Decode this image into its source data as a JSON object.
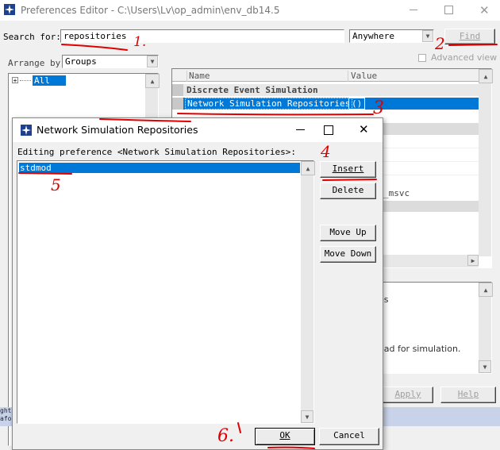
{
  "window": {
    "title": "Preferences Editor - C:\\Users\\Lv\\op_admin\\env_db14.5"
  },
  "search": {
    "label": "Search for:",
    "value": "repositories",
    "scope": "Anywhere",
    "find_label": "Find"
  },
  "arrange": {
    "label": "Arrange by",
    "value": "Groups"
  },
  "tree": {
    "items": [
      "All"
    ]
  },
  "advanced_view": {
    "label": "Advanced view",
    "checked": false
  },
  "table": {
    "headers": [
      "Name",
      "Value"
    ],
    "rows": [
      {
        "name": "Discrete Event Simulation",
        "value": ""
      },
      {
        "name": "Network Simulation Repositories",
        "value": "()"
      }
    ],
    "partial_value": "_msvc"
  },
  "description": {
    "fragment_1": "es",
    "fragment_2": "oad for simulation."
  },
  "footer": {
    "apply_label": "Apply",
    "help_label": "Help"
  },
  "log": {
    "line1": "ght",
    "line2": "afor"
  },
  "dialog": {
    "title": "Network Simulation Repositories",
    "prompt": "Editing preference <Network Simulation Repositories>:",
    "items": [
      "stdmod"
    ],
    "insert_label": "Insert",
    "delete_label": "Delete",
    "move_up_label": "Move Up",
    "move_down_label": "Move Down",
    "ok_label": "OK",
    "cancel_label": "Cancel"
  },
  "annotations": [
    "1.",
    "2",
    "3",
    "4",
    "5",
    "6."
  ]
}
